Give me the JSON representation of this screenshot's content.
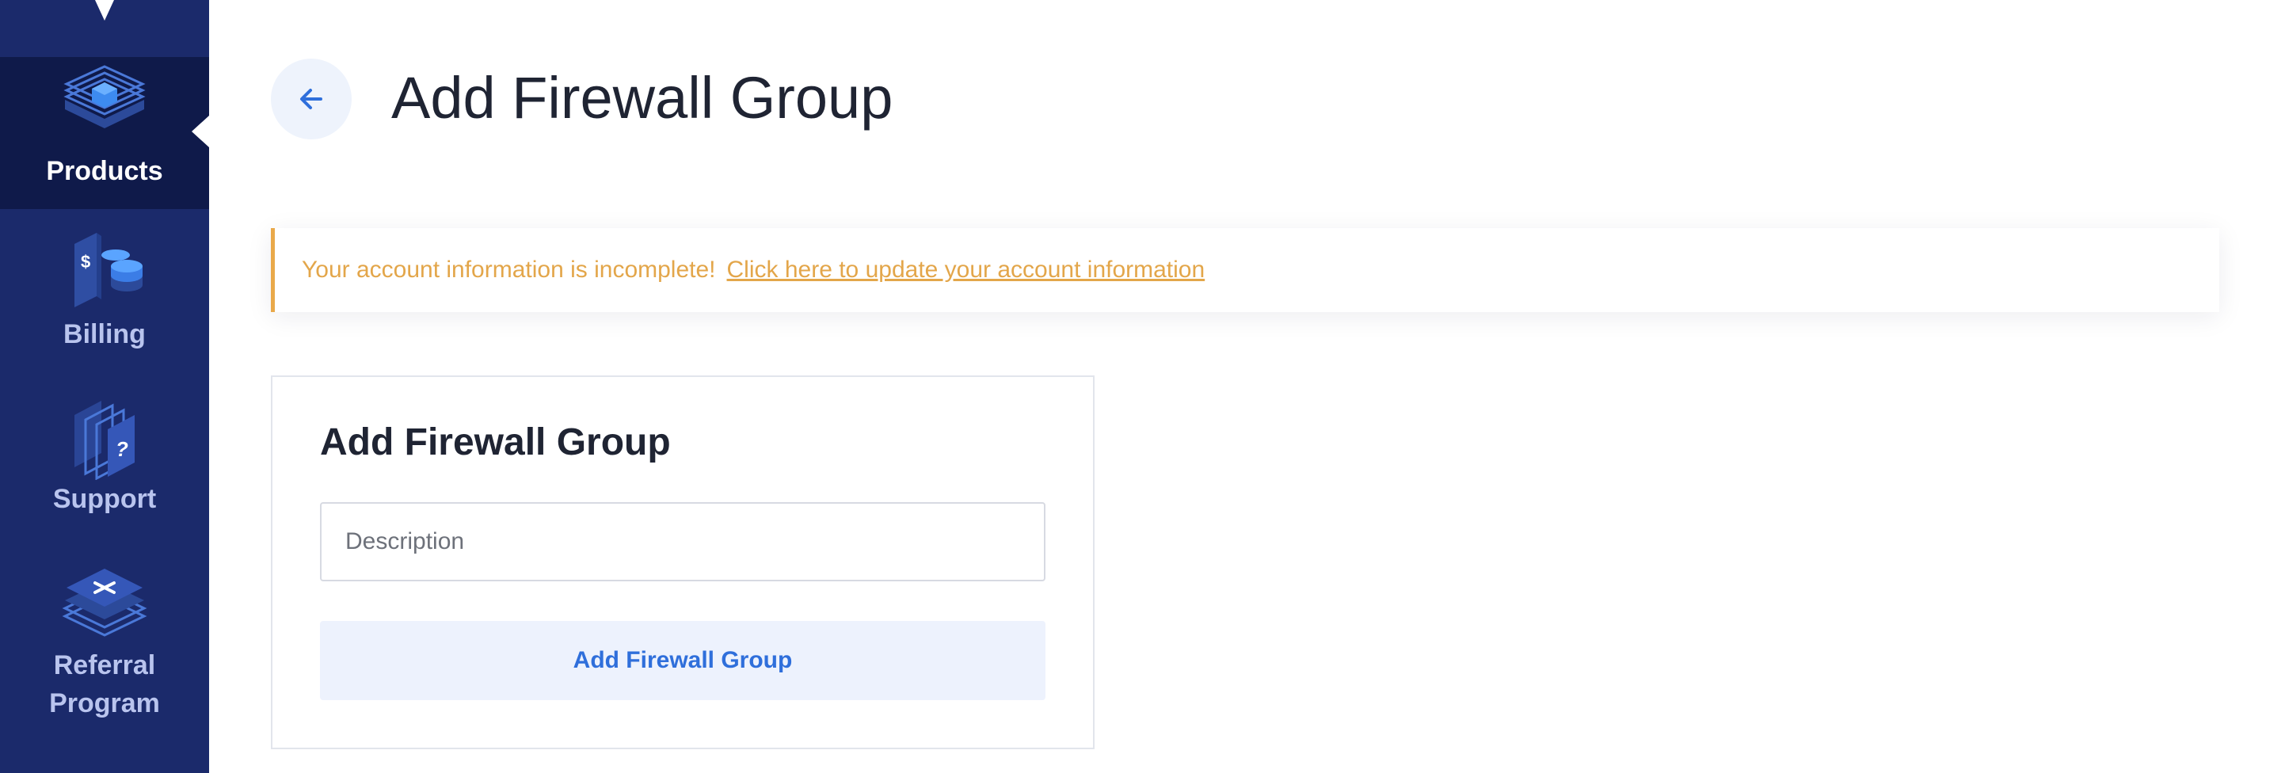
{
  "sidebar": {
    "items": [
      {
        "label": "Products",
        "icon": "products-layers-icon",
        "active": true
      },
      {
        "label": "Billing",
        "icon": "billing-coins-icon",
        "active": false
      },
      {
        "label": "Support",
        "icon": "support-question-icon",
        "active": false
      },
      {
        "label": "Referral Program",
        "icon": "referral-layers-icon",
        "active": false
      }
    ]
  },
  "header": {
    "title": "Add Firewall Group",
    "back_icon": "arrow-left-icon"
  },
  "alert": {
    "message": "Your account information is incomplete!",
    "link_text": "Click here to update your account information",
    "color": "#e3a64a"
  },
  "form": {
    "title": "Add Firewall Group",
    "description_placeholder": "Description",
    "description_value": "",
    "submit_label": "Add Firewall Group"
  },
  "colors": {
    "sidebar_bg": "#1b2a6b",
    "sidebar_active_bg": "#0f1a4a",
    "accent": "#2f6fdb",
    "warning": "#e9a94a"
  }
}
